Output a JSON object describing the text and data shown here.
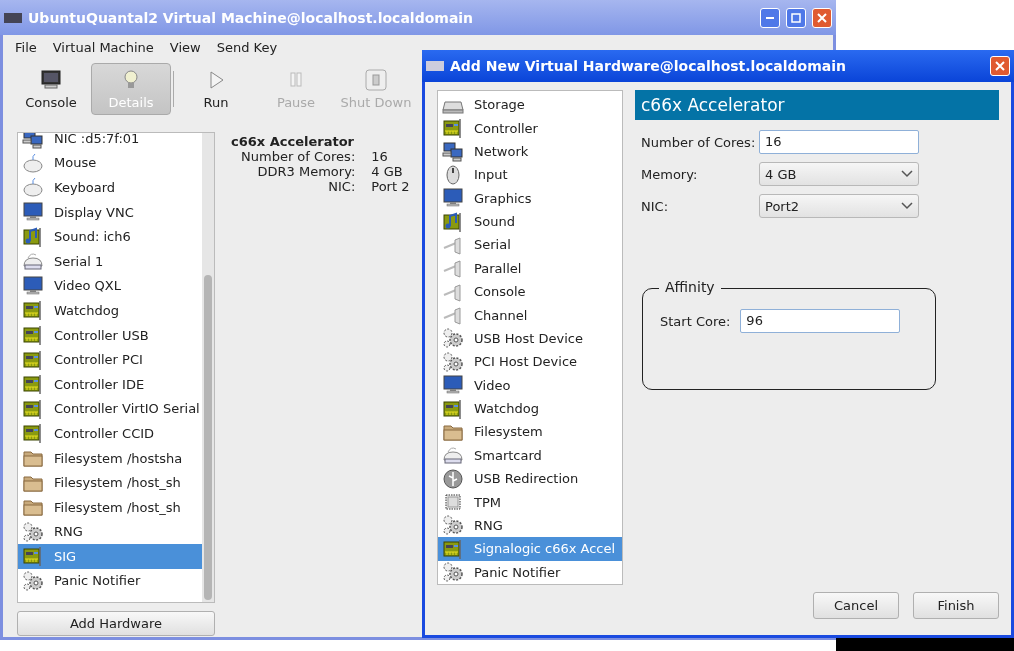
{
  "main_window": {
    "title": "UbuntuQuantal2 Virtual Machine@localhost.localdomain",
    "menu": [
      "File",
      "Virtual Machine",
      "View",
      "Send Key"
    ],
    "toolbar": [
      {
        "kind": "console",
        "label": "Console",
        "selected": false,
        "disabled": false
      },
      {
        "kind": "details",
        "label": "Details",
        "selected": true,
        "disabled": false
      },
      {
        "kind": "run",
        "label": "Run",
        "selected": false,
        "disabled": false
      },
      {
        "kind": "pause",
        "label": "Pause",
        "selected": false,
        "disabled": true
      },
      {
        "kind": "shutdown",
        "label": "Shut Down",
        "selected": false,
        "disabled": true
      }
    ],
    "hardware_list": [
      {
        "kind": "network",
        "label": "NIC :d5:7f:01",
        "selected": false
      },
      {
        "kind": "mouse",
        "label": "Mouse",
        "selected": false
      },
      {
        "kind": "mouse",
        "label": "Keyboard",
        "selected": false
      },
      {
        "kind": "monitor",
        "label": "Display VNC",
        "selected": false
      },
      {
        "kind": "sound",
        "label": "Sound: ich6",
        "selected": false
      },
      {
        "kind": "serial",
        "label": "Serial 1",
        "selected": false
      },
      {
        "kind": "monitor",
        "label": "Video QXL",
        "selected": false
      },
      {
        "kind": "card",
        "label": "Watchdog",
        "selected": false
      },
      {
        "kind": "card",
        "label": "Controller USB",
        "selected": false
      },
      {
        "kind": "card",
        "label": "Controller PCI",
        "selected": false
      },
      {
        "kind": "card",
        "label": "Controller IDE",
        "selected": false
      },
      {
        "kind": "card",
        "label": "Controller VirtIO Serial",
        "selected": false
      },
      {
        "kind": "card",
        "label": "Controller CCID",
        "selected": false
      },
      {
        "kind": "folder",
        "label": "Filesystem /hostsha",
        "selected": false
      },
      {
        "kind": "folder",
        "label": "Filesystem /host_sh",
        "selected": false
      },
      {
        "kind": "folder",
        "label": "Filesystem /host_sh",
        "selected": false
      },
      {
        "kind": "gears",
        "label": "RNG",
        "selected": false
      },
      {
        "kind": "card",
        "label": "SIG",
        "selected": true
      },
      {
        "kind": "gears",
        "label": "Panic Notifier",
        "selected": false
      }
    ],
    "add_button": "Add Hardware",
    "details": {
      "title": "c66x Accelerator",
      "rows": [
        {
          "label": "Number of Cores:",
          "value": "16"
        },
        {
          "label": "DDR3 Memory:",
          "value": "4 GB"
        },
        {
          "label": "NIC:",
          "value": "Port 2"
        }
      ]
    }
  },
  "dialog": {
    "title": "Add New Virtual Hardware@localhost.localdomain",
    "hardware_types": [
      {
        "kind": "disk",
        "label": "Storage",
        "selected": false
      },
      {
        "kind": "card",
        "label": "Controller",
        "selected": false
      },
      {
        "kind": "network",
        "label": "Network",
        "selected": false
      },
      {
        "kind": "input",
        "label": "Input",
        "selected": false
      },
      {
        "kind": "monitor",
        "label": "Graphics",
        "selected": false
      },
      {
        "kind": "sound",
        "label": "Sound",
        "selected": false
      },
      {
        "kind": "plug",
        "label": "Serial",
        "selected": false
      },
      {
        "kind": "plug",
        "label": "Parallel",
        "selected": false
      },
      {
        "kind": "plug",
        "label": "Console",
        "selected": false
      },
      {
        "kind": "plug",
        "label": "Channel",
        "selected": false
      },
      {
        "kind": "gears",
        "label": "USB Host Device",
        "selected": false
      },
      {
        "kind": "gears",
        "label": "PCI Host Device",
        "selected": false
      },
      {
        "kind": "monitor",
        "label": "Video",
        "selected": false
      },
      {
        "kind": "card",
        "label": "Watchdog",
        "selected": false
      },
      {
        "kind": "folder",
        "label": "Filesystem",
        "selected": false
      },
      {
        "kind": "serial",
        "label": "Smartcard",
        "selected": false
      },
      {
        "kind": "usb",
        "label": "USB Redirection",
        "selected": false
      },
      {
        "kind": "chip",
        "label": "TPM",
        "selected": false
      },
      {
        "kind": "gears",
        "label": "RNG",
        "selected": false
      },
      {
        "kind": "card",
        "label": "Signalogic c66x Accel",
        "selected": true
      },
      {
        "kind": "gears",
        "label": "Panic Notifier",
        "selected": false
      }
    ],
    "header": "c66x Accelerator",
    "fields": [
      {
        "kind": "text",
        "label": "Number of Cores:",
        "value": "16"
      },
      {
        "kind": "select",
        "label": "Memory:",
        "value": "4 GB"
      },
      {
        "kind": "select",
        "label": "NIC:",
        "value": "Port2"
      }
    ],
    "affinity": {
      "legend": "Affinity",
      "label": "Start Core:",
      "value": "96"
    },
    "buttons": [
      "Cancel",
      "Finish"
    ]
  }
}
